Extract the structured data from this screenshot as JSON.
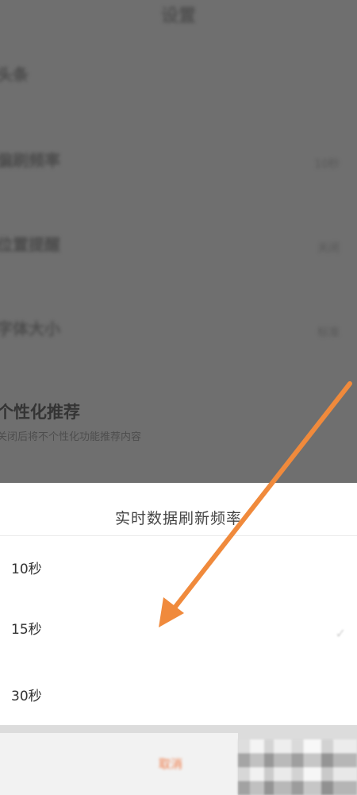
{
  "page": {
    "title": "设置",
    "settings": [
      {
        "title": "头条",
        "subtitle": "",
        "value": ""
      },
      {
        "title": "偏刷频率",
        "subtitle": "",
        "value": "10秒"
      },
      {
        "title": "位置提醒",
        "subtitle": "",
        "value": "关闭"
      },
      {
        "title": "字体大小",
        "subtitle": "",
        "value": "标准"
      },
      {
        "title": "个性化推荐",
        "subtitle": "关闭后将不个性化功能推荐内容",
        "value": ""
      }
    ]
  },
  "sheet": {
    "title": "实时数据刷新频率",
    "options": [
      "10秒",
      "15秒",
      "30秒"
    ],
    "check_icon": "check-icon"
  },
  "bottom_bar": {
    "cancel_label": "取消"
  },
  "colors": {
    "accent": "#ee7a47",
    "arrow": "#f08a3c"
  }
}
